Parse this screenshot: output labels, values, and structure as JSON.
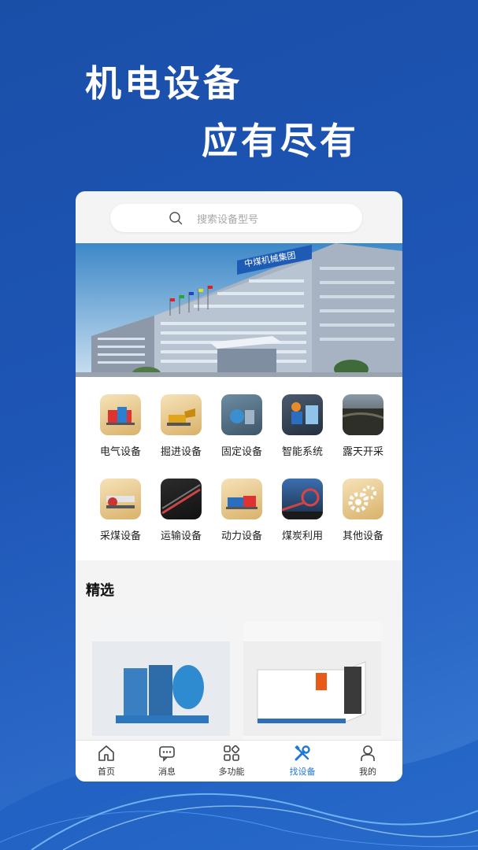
{
  "headline": {
    "line1": "机电设备",
    "line2": "应有尽有"
  },
  "search": {
    "placeholder": "搜索设备型号"
  },
  "banner": {
    "sign": "中煤机械集团"
  },
  "categories": [
    {
      "label": "电气设备",
      "icon": "electrical-equipment-icon"
    },
    {
      "label": "掘进设备",
      "icon": "tunneling-equipment-icon"
    },
    {
      "label": "固定设备",
      "icon": "fixed-equipment-icon"
    },
    {
      "label": "智能系统",
      "icon": "smart-system-icon"
    },
    {
      "label": "露天开采",
      "icon": "open-pit-mining-icon"
    },
    {
      "label": "采煤设备",
      "icon": "coal-mining-equipment-icon"
    },
    {
      "label": "运输设备",
      "icon": "transport-equipment-icon"
    },
    {
      "label": "动力设备",
      "icon": "power-equipment-icon"
    },
    {
      "label": "煤炭利用",
      "icon": "coal-utilization-icon"
    },
    {
      "label": "其他设备",
      "icon": "gears-icon"
    }
  ],
  "featured": {
    "title": "精选"
  },
  "tabbar": {
    "active": "找设备",
    "accent": "#1f76d9",
    "items": [
      {
        "label": "首页",
        "icon": "home-icon"
      },
      {
        "label": "消息",
        "icon": "message-icon"
      },
      {
        "label": "多功能",
        "icon": "apps-icon"
      },
      {
        "label": "找设备",
        "icon": "tools-icon"
      },
      {
        "label": "我的",
        "icon": "user-icon"
      }
    ]
  }
}
